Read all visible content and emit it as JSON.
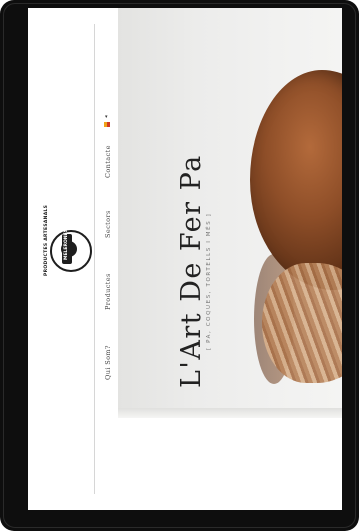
{
  "nav": {
    "items": [
      {
        "label": "Qui Som?"
      },
      {
        "label": "Productes"
      },
      {
        "label": "Sectors"
      },
      {
        "label": "Contacte"
      }
    ],
    "language_flag": "catalan-flag-icon"
  },
  "logo": {
    "arc_text": "PRODUCTES ARTESANALS",
    "brand": "MELERONES"
  },
  "hero": {
    "title": "L'Art De Fer Pa",
    "subtitle": "[ PA, COQUES, TORTELLS I MÉS ]"
  },
  "colors": {
    "accent_orange": "#f0a31a",
    "accent_red": "#d13a22",
    "text_dark": "#222222"
  }
}
